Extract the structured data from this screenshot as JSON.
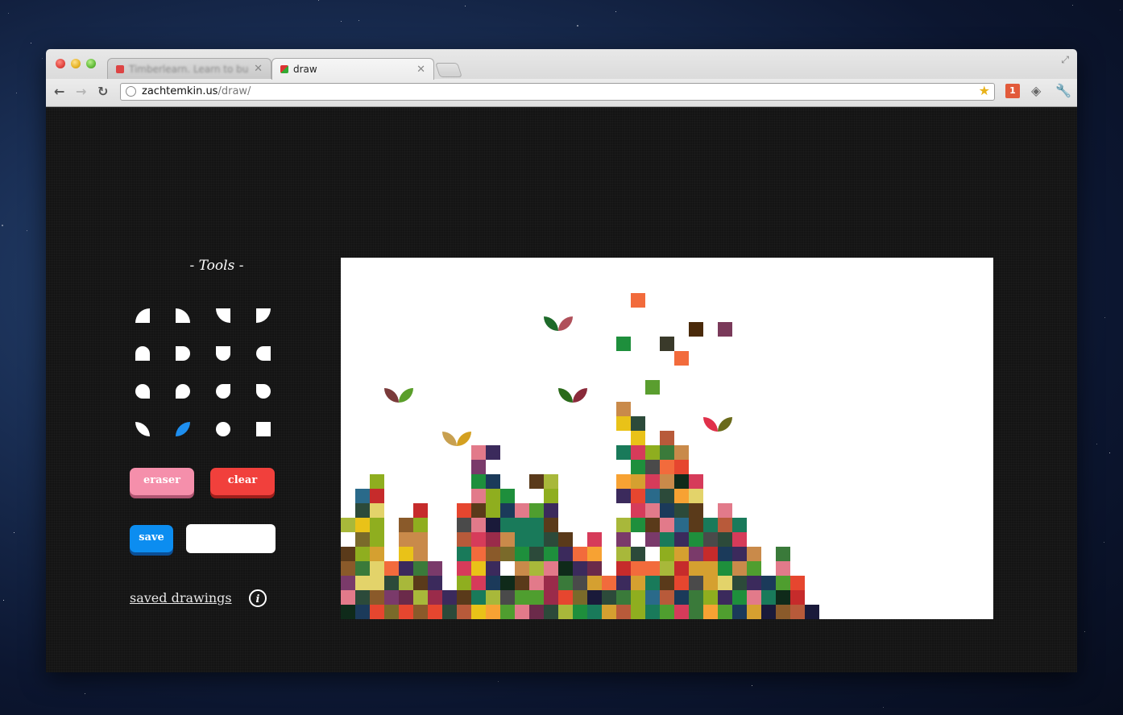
{
  "browser": {
    "tabs": [
      {
        "title": "Timberlearn. Learn to build…",
        "active": false
      },
      {
        "title": "draw",
        "active": true
      }
    ],
    "url_host": "zachtemkin.us",
    "url_path": "/draw/",
    "extension_badge": "1"
  },
  "tools": {
    "title": "- Tools -",
    "shapes": [
      "quarter-circle-top-left-icon",
      "quarter-circle-top-right-icon",
      "quarter-circle-bottom-left-icon",
      "quarter-circle-bottom-right-icon",
      "half-round-top-icon",
      "half-round-right-icon",
      "half-round-bottom-icon",
      "half-round-left-icon",
      "teardrop-top-left-icon",
      "teardrop-top-right-icon",
      "teardrop-bottom-left-icon",
      "teardrop-bottom-right-icon",
      "leaf-left-icon",
      "leaf-right-icon",
      "circle-icon",
      "square-icon"
    ],
    "selected_shape": "leaf-right-icon",
    "selected_color": "#1e8ff0"
  },
  "buttons": {
    "eraser": "eraser",
    "clear": "clear",
    "save": "save"
  },
  "save_name_value": "",
  "saved_drawings_label": "saved drawings",
  "info_label": "i",
  "colors": {
    "eraser": "#f58fab",
    "clear": "#f1403c",
    "save": "#0c8df0",
    "canvas": "#ffffff"
  }
}
